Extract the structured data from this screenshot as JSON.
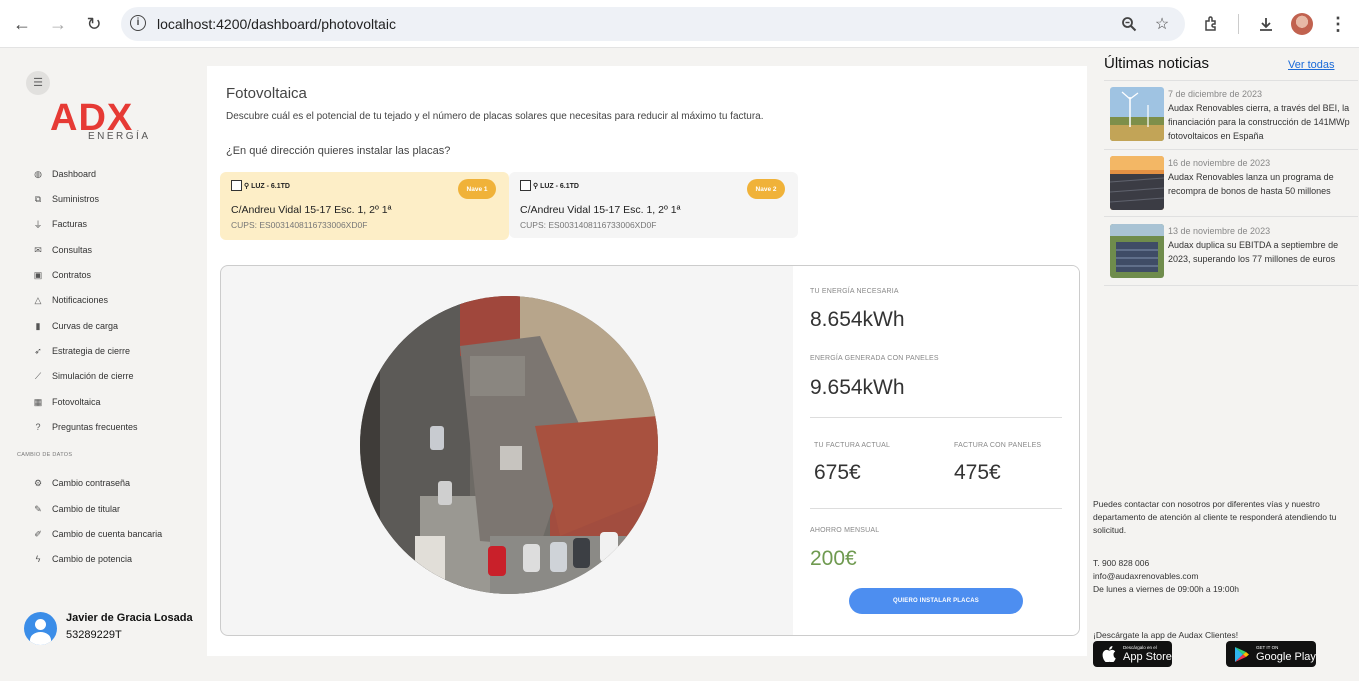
{
  "browser": {
    "url": "localhost:4200/dashboard/photovoltaic"
  },
  "sidebar": {
    "logo_main": "ADX",
    "logo_sub": "ENERGÍA",
    "items": [
      {
        "label": "Dashboard",
        "icon": "dashboard-icon"
      },
      {
        "label": "Suministros",
        "icon": "supplies-icon"
      },
      {
        "label": "Facturas",
        "icon": "invoices-icon"
      },
      {
        "label": "Consultas",
        "icon": "mail-icon"
      },
      {
        "label": "Contratos",
        "icon": "briefcase-icon"
      },
      {
        "label": "Notificaciones",
        "icon": "bell-icon"
      },
      {
        "label": "Curvas de carga",
        "icon": "bar-chart-icon"
      },
      {
        "label": "Estrategia de cierre",
        "icon": "rocket-icon"
      },
      {
        "label": "Simulación de cierre",
        "icon": "line-chart-icon"
      },
      {
        "label": "Fotovoltaica",
        "icon": "solar-panel-icon"
      },
      {
        "label": "Preguntas frecuentes",
        "icon": "help-icon"
      }
    ],
    "section_title": "CAMBIO DE DATOS",
    "data_items": [
      {
        "label": "Cambio contraseña",
        "icon": "gear-icon"
      },
      {
        "label": "Cambio de titular",
        "icon": "pencil-icon"
      },
      {
        "label": "Cambio de cuenta bancaria",
        "icon": "edit-icon"
      },
      {
        "label": "Cambio de potencia",
        "icon": "bolt-icon"
      }
    ]
  },
  "user": {
    "name": "Javier de Gracia Losada",
    "id": "53289229T"
  },
  "main": {
    "title": "Fotovoltaica",
    "description": "Descubre cuál es el potencial de tu tejado y el número de placas solares que necesitas para reducir al máximo tu factura.",
    "question": "¿En qué dirección quieres instalar las placas?",
    "supplies": [
      {
        "type": "LUZ - 6.1TD",
        "nave": "Nave 1",
        "address": "C/Andreu Vidal 15-17 Esc. 1, 2º 1ª",
        "cups": "CUPS: ES0031408116733006XD0F",
        "selected": true
      },
      {
        "type": "LUZ - 6.1TD",
        "nave": "Nave 2",
        "address": "C/Andreu Vidal 15-17 Esc. 1, 2º 1ª",
        "cups": "CUPS: ES0031408116733006XD0F",
        "selected": false
      }
    ],
    "stats": {
      "needed_label": "TU ENERGÍA NECESARIA",
      "needed_value": "8.654kWh",
      "generated_label": "ENERGÍA GENERADA CON PANELES",
      "generated_value": "9.654kWh",
      "current_bill_label": "TU FACTURA ACTUAL",
      "current_bill_value": "675€",
      "panel_bill_label": "FACTURA CON PANELES",
      "panel_bill_value": "475€",
      "saving_label": "AHORRO MENSUAL",
      "saving_value": "200€",
      "cta_label": "QUIERO INSTALAR PLACAS"
    }
  },
  "news": {
    "title": "Últimas noticias",
    "see_all": "Ver todas",
    "items": [
      {
        "date": "7 de diciembre de 2023",
        "text": "Audax Renovables cierra, a través del BEI, la financiación para la construcción de 141MWp fotovoltaicos en España"
      },
      {
        "date": "16 de noviembre de 2023",
        "text": "Audax Renovables lanza un programa de recompra de bonos de hasta 50 millones"
      },
      {
        "date": "13 de noviembre de 2023",
        "text": "Audax duplica su EBITDA a septiembre de 2023, superando los 77 millones de euros"
      }
    ]
  },
  "contact": {
    "intro": "Puedes contactar con nosotros por diferentes vías y nuestro departamento de atención al cliente te responderá atendiendo tu solicitud.",
    "phone": "T. 900 828 006",
    "email": "info@audaxrenovables.com",
    "hours": "De lunes a viernes de 09:00h a 19:00h",
    "app_prompt": "¡Descárgate la app de Audax Clientes!",
    "appstore_small": "Descárgalo en el",
    "appstore_big": "App Store",
    "googleplay_small": "GET IT ON",
    "googleplay_big": "Google Play"
  },
  "colors": {
    "accent": "#4d8ef0",
    "brand": "#e63a35",
    "selected_card": "#fdeec7",
    "badge": "#f0b239",
    "saving": "#6f9a50"
  }
}
